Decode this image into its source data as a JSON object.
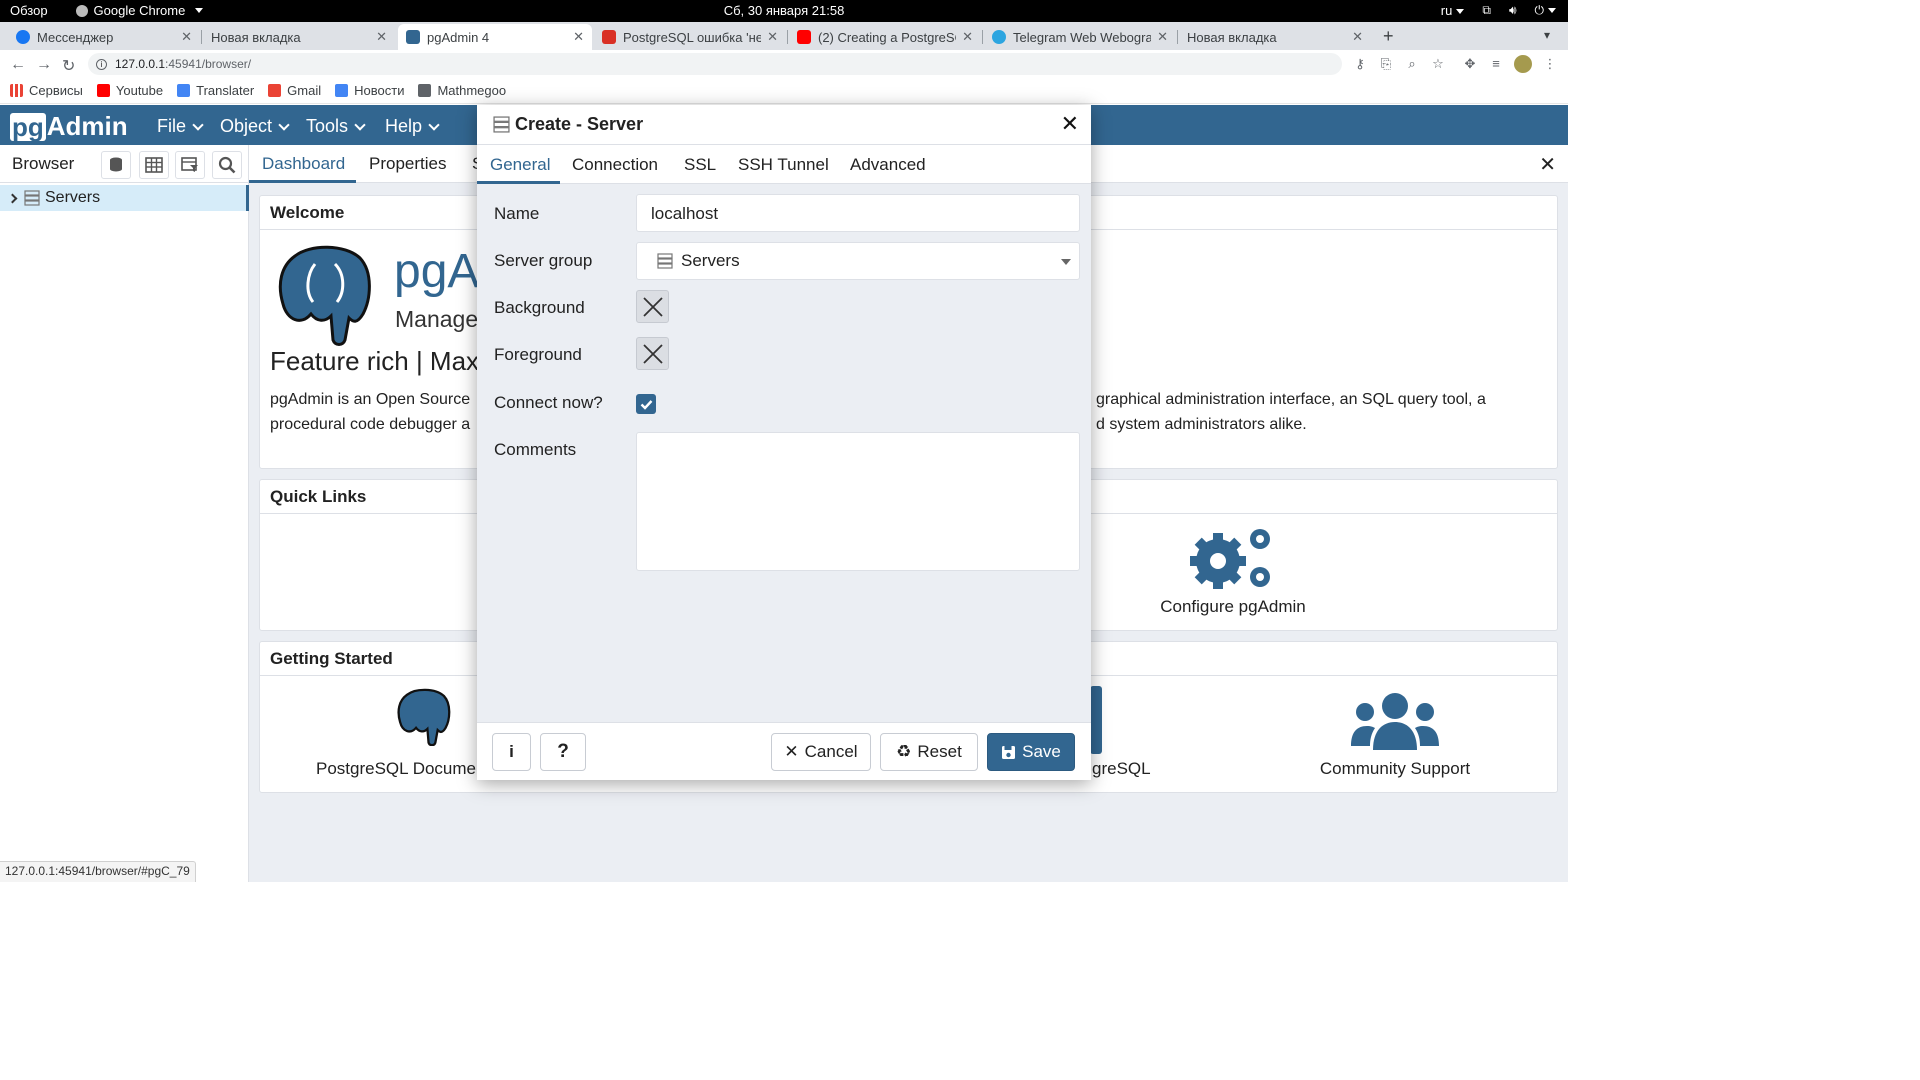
{
  "topbar": {
    "overview": "Обзор",
    "app_name": "Google Chrome",
    "datetime": "Сб, 30 января  21:58",
    "lang": "ru"
  },
  "chrome_tabs": [
    {
      "title": "Мессенджер",
      "icon_color": "#1877f2"
    },
    {
      "title": "Новая вкладка",
      "icon_color": ""
    },
    {
      "title": "pgAdmin 4",
      "icon_color": "#326690"
    },
    {
      "title": "PostgreSQL ошибка 'не у",
      "icon_color": "#d93025"
    },
    {
      "title": "(2) Creating a PostgreSQL",
      "icon_color": "#ff0000"
    },
    {
      "title": "Telegram Web Webogram",
      "icon_color": "#2ca5e0"
    },
    {
      "title": "Новая вкладка",
      "icon_color": ""
    }
  ],
  "address": {
    "host": "127.0.0.1",
    "rest": ":45941/browser/"
  },
  "bookmarks": [
    {
      "label": "Сервисы",
      "icon_color": "#ea4335"
    },
    {
      "label": "Youtube",
      "icon_color": "#ff0000"
    },
    {
      "label": "Translater",
      "icon_color": "#4285f4"
    },
    {
      "label": "Gmail",
      "icon_color": "#ea4335"
    },
    {
      "label": "Новости",
      "icon_color": "#4285f4"
    },
    {
      "label": "Mathmegoo",
      "icon_color": "#5f6368"
    }
  ],
  "pgadmin": {
    "logo_pg": "pg",
    "logo_admin": "Admin",
    "menus": [
      "File",
      "Object",
      "Tools",
      "Help"
    ]
  },
  "browser_panel": {
    "title": "Browser",
    "tree_item": "Servers"
  },
  "dashboard": {
    "tabs": [
      "Dashboard",
      "Properties",
      "S"
    ],
    "welcome_title": "Welcome",
    "hero_title": "pgA",
    "hero_sub": "Manage",
    "feature_line": "Feature rich | Maxi",
    "desc_left_1": "pgAdmin is an Open Source",
    "desc_left_2": "procedural code debugger a",
    "desc_right_1": "graphical administration interface, an SQL query tool, a",
    "desc_right_2": "d system administrators alike.",
    "quick_links_title": "Quick Links",
    "configure_label": "Configure pgAdmin",
    "getting_started_title": "Getting Started",
    "pg_docs_label": "PostgreSQL Documen",
    "pg_right_label": "greSQL",
    "community_label": "Community Support"
  },
  "dialog": {
    "title": "Create - Server",
    "tabs": [
      "General",
      "Connection",
      "SSL",
      "SSH Tunnel",
      "Advanced"
    ],
    "labels": {
      "name": "Name",
      "server_group": "Server group",
      "background": "Background",
      "foreground": "Foreground",
      "connect_now": "Connect now?",
      "comments": "Comments"
    },
    "values": {
      "name": "localhost",
      "server_group": "Servers",
      "connect_now": true,
      "comments": ""
    },
    "buttons": {
      "info": "i",
      "help": "?",
      "cancel": "Cancel",
      "reset": "Reset",
      "save": "Save"
    },
    "accent": "#326690"
  },
  "status_url": "127.0.0.1:45941/browser/#pgC_79"
}
